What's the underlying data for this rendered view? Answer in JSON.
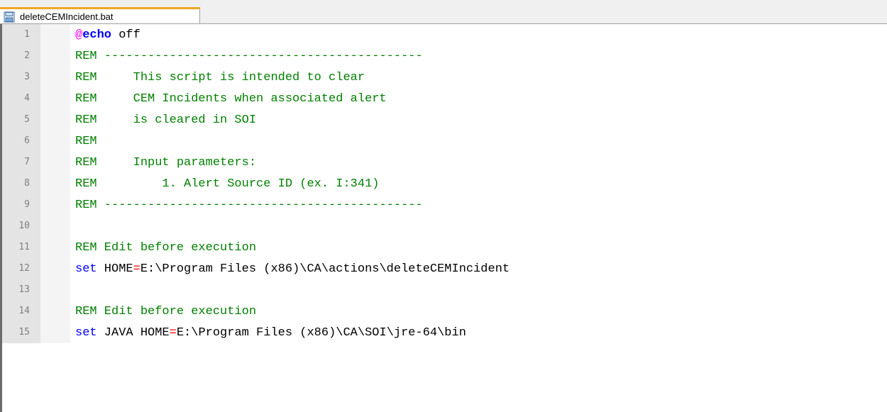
{
  "tab": {
    "label": "deleteCEMIncident.bat",
    "icon": "save-file-icon"
  },
  "colors": {
    "comment": "#008000",
    "keyword": "#0000ff",
    "echo_at": "#ff00ff",
    "operator": "#ff0000",
    "tab_accent": "#f5a623",
    "line_number": "#808080"
  },
  "lines": [
    {
      "num": "1",
      "segments": [
        {
          "t": "@",
          "c": "at"
        },
        {
          "t": "echo",
          "c": "echo"
        },
        {
          "t": " off",
          "c": "default"
        }
      ]
    },
    {
      "num": "2",
      "segments": [
        {
          "t": "REM --------------------------------------------",
          "c": "comment"
        }
      ]
    },
    {
      "num": "3",
      "segments": [
        {
          "t": "REM     This script is intended to clear",
          "c": "comment"
        }
      ]
    },
    {
      "num": "4",
      "segments": [
        {
          "t": "REM     CEM Incidents when associated alert",
          "c": "comment"
        }
      ]
    },
    {
      "num": "5",
      "segments": [
        {
          "t": "REM     is cleared in SOI",
          "c": "comment"
        }
      ]
    },
    {
      "num": "6",
      "segments": [
        {
          "t": "REM",
          "c": "comment"
        }
      ]
    },
    {
      "num": "7",
      "segments": [
        {
          "t": "REM     Input parameters:",
          "c": "comment"
        }
      ]
    },
    {
      "num": "8",
      "segments": [
        {
          "t": "REM         1. Alert Source ID (ex. I:341)",
          "c": "comment"
        }
      ]
    },
    {
      "num": "9",
      "segments": [
        {
          "t": "REM --------------------------------------------",
          "c": "comment"
        }
      ]
    },
    {
      "num": "10",
      "segments": []
    },
    {
      "num": "11",
      "segments": [
        {
          "t": "REM Edit before execution",
          "c": "comment"
        }
      ]
    },
    {
      "num": "12",
      "segments": [
        {
          "t": "set",
          "c": "keyword"
        },
        {
          "t": " HOME",
          "c": "default"
        },
        {
          "t": "=",
          "c": "op"
        },
        {
          "t": "E:\\Program Files (x86)\\CA\\actions\\deleteCEMIncident",
          "c": "default"
        }
      ]
    },
    {
      "num": "13",
      "segments": []
    },
    {
      "num": "14",
      "segments": [
        {
          "t": "REM Edit before execution",
          "c": "comment"
        }
      ]
    },
    {
      "num": "15",
      "segments": [
        {
          "t": "set",
          "c": "keyword"
        },
        {
          "t": " JAVA HOME",
          "c": "default"
        },
        {
          "t": "=",
          "c": "op"
        },
        {
          "t": "E:\\Program Files (x86)\\CA\\SOI\\jre-64\\bin",
          "c": "default"
        }
      ]
    }
  ]
}
